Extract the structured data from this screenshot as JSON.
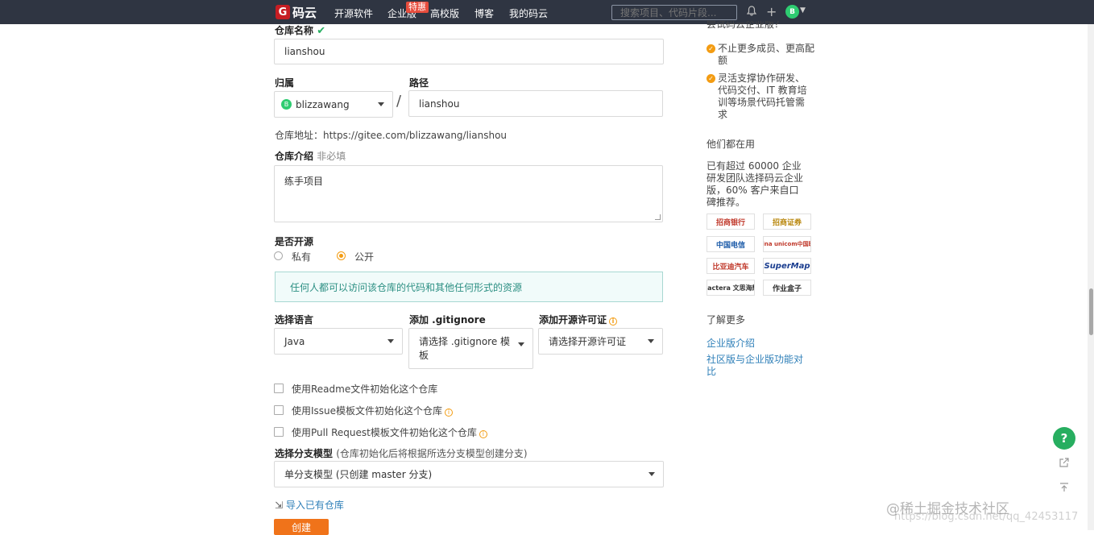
{
  "header": {
    "logo": "码云",
    "logo_letter": "G",
    "nav": [
      "开源软件",
      "企业版",
      "高校版",
      "博客",
      "我的码云"
    ],
    "badge": "特惠",
    "search_placeholder": "搜索项目、代码片段...",
    "avatar": "B"
  },
  "form": {
    "name_label": "仓库名称",
    "name_value": "lianshou",
    "owner_label": "归属",
    "owner_avatar": "B",
    "owner_value": "blizzawang",
    "slash": "/",
    "path_label": "路径",
    "path_value": "lianshou",
    "url_text": "仓库地址：https://gitee.com/blizzawang/lianshou",
    "intro_label": "仓库介绍",
    "intro_optional": "非必填",
    "intro_value": "练手项目",
    "open_label": "是否开源",
    "radio_private": "私有",
    "radio_public": "公开",
    "notice": "任何人都可以访问该仓库的代码和其他任何形式的资源",
    "lang_label": "选择语言",
    "lang_value": "Java",
    "gitignore_label": "添加 .gitignore",
    "gitignore_value": "请选择 .gitignore 模板",
    "license_label": "添加开源许可证",
    "license_value": "请选择开源许可证",
    "cb_readme": "使用Readme文件初始化这个仓库",
    "cb_issue": "使用Issue模板文件初始化这个仓库",
    "cb_pr": "使用Pull Request模板文件初始化这个仓库",
    "branch_label": "选择分支模型",
    "branch_hint": "(仓库初始化后将根据所选分支模型创建分支)",
    "branch_value": "单分支模型 (只创建 master 分支)",
    "import_link": "导入已有仓库",
    "create_button": "创建"
  },
  "sidebar": {
    "try_text": "尝试码云企业版？",
    "bullet1": "不止更多成员、更高配额",
    "bullet2": "灵活支撑协作研发、代码交付、IT 教育培训等场景代码托管需求",
    "users_title": "他们都在用",
    "users_text": "已有超过 60000 企业研发团队选择码云企业版，60% 客户来自口碑推荐。",
    "logos": [
      "招商银行",
      "招商证券",
      "中国电信",
      "China unicom中国联通",
      "比亚迪汽车",
      "SuperMap",
      "pactera 文思海辉",
      "作业盒子"
    ],
    "learn_title": "了解更多",
    "link1": "企业版介绍",
    "link2": "社区版与企业版功能对比"
  },
  "floating": {
    "help": "?"
  },
  "watermark": "@稀土掘金技术社区",
  "watermark_url": "https://blog.csdn.net/qq_42453117"
}
